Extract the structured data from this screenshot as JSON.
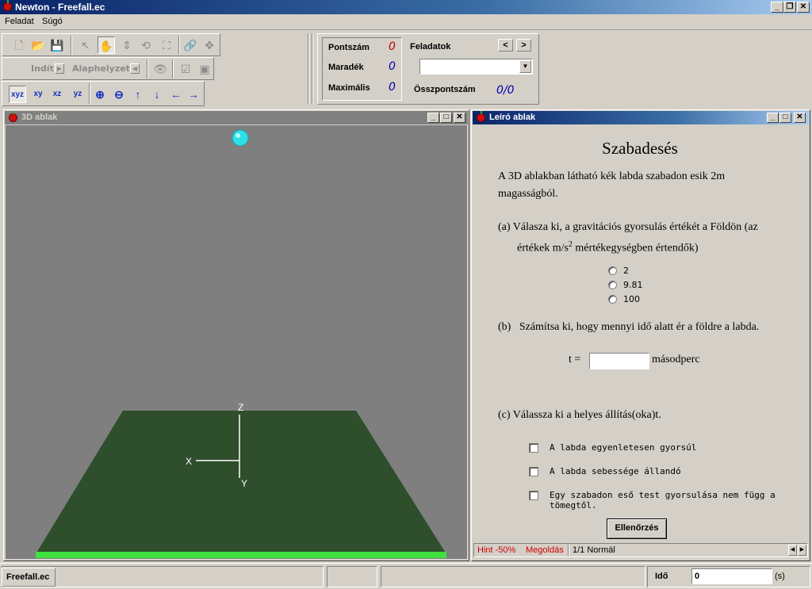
{
  "window": {
    "title": "Newton - Freefall.ec",
    "buttons": [
      "_",
      "❐",
      "✕"
    ]
  },
  "menu": [
    {
      "label": "Feladat"
    },
    {
      "label": "Súgó"
    }
  ],
  "toolbar": {
    "start_label": "Indít",
    "reset_label": "Alaphelyzet"
  },
  "score": {
    "points_label": "Pontszám",
    "points_value": "0",
    "remaining_label": "Maradék",
    "remaining_value": "0",
    "max_label": "Maximális",
    "max_value": "0",
    "tasks_label": "Feladatok",
    "total_label": "Összpontszám",
    "total_value": "0/0",
    "prev": "<",
    "next": ">",
    "task_select_value": ""
  },
  "view3d": {
    "title": "3D ablak",
    "axes": {
      "x": "X",
      "y": "Y",
      "z": "Z"
    }
  },
  "desc": {
    "title": "Leíró ablak",
    "heading": "Szabadesés",
    "intro_line1": "A 3D ablakban látható kék labda szabadon esik 2m",
    "intro_line2": "magasságból.",
    "qa_line1": "(a) Válasza ki, a gravitációs gyorsulás értékét a Földön (az",
    "qa_line2_pre": "értékek m/s",
    "qa_line2_sup": "2",
    "qa_line2_post": " mértékegységben értendők)",
    "options": [
      "2",
      "9.81",
      "100"
    ],
    "qb": "(b)   Számítsa ki, hogy mennyi idő alatt ér a földre a labda.",
    "t_label": "t =",
    "t_value": "",
    "t_unit": "másodperc",
    "qc": "(c) Válassza ki a helyes állítás(oka)t.",
    "checks": [
      "A labda egyenletesen gyorsúl",
      "A labda sebessége állandó",
      "Egy szabadon eső test gyorsulása nem függ a tömegtől."
    ],
    "check_button": "Ellenőrzés",
    "hint_label": "Hint -50%",
    "solution_label": "Megoldás",
    "page_label": "1/1 Normál"
  },
  "statusbar": {
    "file": "Freefall.ec",
    "time_label": "Idő",
    "time_value": "0",
    "time_unit": "(s)"
  },
  "colors": {
    "title_active": "#0a246a",
    "title_inactive": "#808080",
    "scene_bg": "#7f7f7f",
    "ground": "#2e4e2c",
    "ground_edge": "#3fe03f",
    "ball": "#2ee0e6",
    "score_points": "#c00000",
    "score_blue": "#0000b0",
    "hint_red": "#d00000"
  }
}
